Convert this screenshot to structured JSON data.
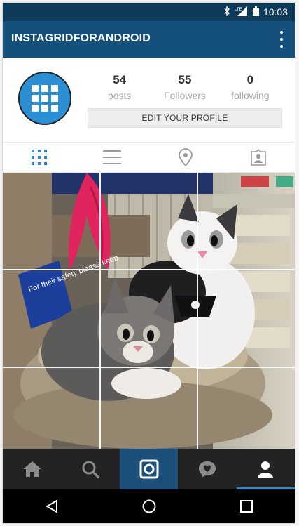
{
  "status_bar": {
    "time": "10:03",
    "icons": [
      "bluetooth-icon",
      "signal-lte-icon",
      "battery-icon"
    ]
  },
  "app_bar": {
    "title": "INSTAGRIDFORANDROID",
    "menu_icon": "overflow-menu-icon"
  },
  "profile": {
    "avatar_icon": "grid-app-icon",
    "avatar_color": "#2c8fd4",
    "stats": [
      {
        "value": "54",
        "label": "posts"
      },
      {
        "value": "55",
        "label": "Followers"
      },
      {
        "value": "0",
        "label": "following"
      }
    ],
    "edit_button_label": "EDIT YOUR PROFILE"
  },
  "view_tabs": [
    {
      "icon": "grid-view-icon",
      "active": true
    },
    {
      "icon": "list-view-icon",
      "active": false
    },
    {
      "icon": "location-pin-icon",
      "active": false
    },
    {
      "icon": "tagged-photos-icon",
      "active": false
    }
  ],
  "photo": {
    "sign_text": "For their safety please keep",
    "grid": "3x3"
  },
  "bottom_nav": [
    {
      "icon": "home-icon"
    },
    {
      "icon": "search-icon"
    },
    {
      "icon": "camera-icon"
    },
    {
      "icon": "activity-heart-icon"
    },
    {
      "icon": "profile-icon",
      "active": true
    }
  ],
  "system_nav": [
    "back-icon",
    "home-circle-icon",
    "recents-icon"
  ],
  "colors": {
    "status_bar": "#0e3a5a",
    "app_bar": "#15507c",
    "accent": "#2e8ad0",
    "camera_tab": "#1c4f7a",
    "nav_bg": "#232323"
  }
}
